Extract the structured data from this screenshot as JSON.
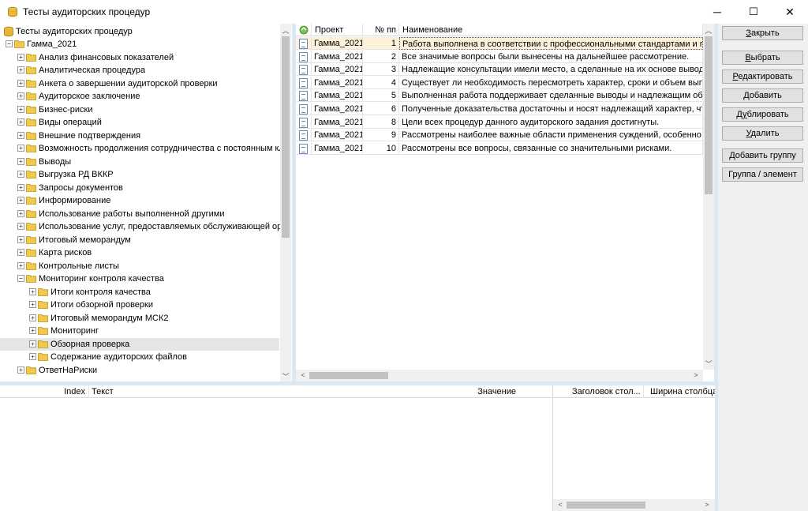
{
  "window": {
    "title": "Тесты аудиторских процедур",
    "minimize": "─",
    "maximize": "☐",
    "close": "✕"
  },
  "tree": {
    "root": "Тесты аудиторских процедур",
    "project": "Гамма_2021",
    "items": [
      {
        "label": "Анализ финансовых показателей"
      },
      {
        "label": "Аналитическая процедура"
      },
      {
        "label": "Анкета о завершении аудиторской проверки"
      },
      {
        "label": "Аудиторское заключение"
      },
      {
        "label": "Бизнес-риски"
      },
      {
        "label": "Виды операций"
      },
      {
        "label": "Внешние подтверждения"
      },
      {
        "label": "Возможность продолжения сотрудничества с постоянным кли..."
      },
      {
        "label": "Выводы"
      },
      {
        "label": "Выгрузка РД ВККР"
      },
      {
        "label": "Запросы документов"
      },
      {
        "label": "Информирование"
      },
      {
        "label": "Использование работы выполненной другими"
      },
      {
        "label": "Использование услуг, предоставляемых обслуживающей орг..."
      },
      {
        "label": "Итоговый меморандум"
      },
      {
        "label": "Карта рисков"
      },
      {
        "label": "Контрольные листы"
      },
      {
        "label": "Мониторинг контроля качества"
      }
    ],
    "subitems": [
      {
        "label": "Итоги контроля качества"
      },
      {
        "label": "Итоги обзорной проверки"
      },
      {
        "label": "Итоговый меморандум МСК2"
      },
      {
        "label": "Мониторинг"
      },
      {
        "label": "Обзорная проверка"
      },
      {
        "label": "Содержание аудиторских файлов"
      }
    ],
    "after": [
      {
        "label": "ОтветНаРиски"
      }
    ]
  },
  "grid": {
    "headers": {
      "project": "Проект",
      "num": "№ пп",
      "name": "Наименование"
    },
    "rows": [
      {
        "project": "Гамма_2021",
        "num": "1",
        "name": "Работа выполнена в соответствии с профессиональными стандартами и примени"
      },
      {
        "project": "Гамма_2021",
        "num": "2",
        "name": "Все значимые вопросы были вынесены на дальнейшее рассмотрение."
      },
      {
        "project": "Гамма_2021",
        "num": "3",
        "name": "Надлежащие консультации имели место, а сделанные на их основе выводы задо"
      },
      {
        "project": "Гамма_2021",
        "num": "4",
        "name": "Существует ли необходимость пересмотреть характер, сроки и объем выполнен"
      },
      {
        "project": "Гамма_2021",
        "num": "5",
        "name": "Выполненная работа поддерживает сделанные выводы и надлежащим образом з"
      },
      {
        "project": "Гамма_2021",
        "num": "6",
        "name": "Полученные доказательства достаточны и носят надлежащий характер, чтобы"
      },
      {
        "project": "Гамма_2021",
        "num": "8",
        "name": "Цели всех процедур данного аудиторского задания достигнуты."
      },
      {
        "project": "Гамма_2021",
        "num": "9",
        "name": "Рассмотрены наиболее важные области применения суждений, особенно связан"
      },
      {
        "project": "Гамма_2021",
        "num": "10",
        "name": "Рассмотрены все вопросы, связанные со значительными рисками."
      }
    ]
  },
  "buttons": {
    "close": {
      "pre": "",
      "u": "З",
      "post": "акрыть"
    },
    "select": {
      "pre": "",
      "u": "В",
      "post": "ыбрать"
    },
    "edit": {
      "pre": "",
      "u": "Р",
      "post": "едактировать"
    },
    "add": {
      "pre": "",
      "u": "Д",
      "post": "обавить"
    },
    "duplicate": {
      "pre": "Д",
      "u": "у",
      "post": "блировать"
    },
    "delete": {
      "pre": "",
      "u": "У",
      "post": "далить"
    },
    "add_group": "Добавить группу",
    "group_element": "Группа / элемент"
  },
  "bottom": {
    "index": "Index",
    "text": "Текст",
    "value": "Значение",
    "col_title": "Заголовок стол...",
    "col_width": "Ширина столбца"
  },
  "colors": {
    "accent_row": "#fdf1da",
    "folder": "#f2c94c",
    "splitter": "#d9e8f3"
  }
}
